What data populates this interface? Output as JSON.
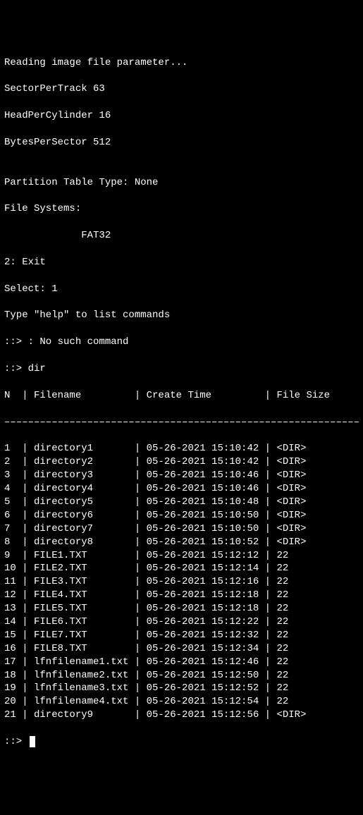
{
  "header": {
    "reading": "Reading image file parameter...",
    "sector": "SectorPerTrack 63",
    "head": "HeadPerCylinder 16",
    "bytes": "BytesPerSector 512",
    "blank1": "",
    "partition": "Partition Table Type: None",
    "fs_label": "File Systems:",
    "fs_value": "             FAT32",
    "exit": "2: Exit",
    "select": "Select: 1",
    "help": "Type \"help\" to list commands",
    "nosuch": "::> : No such command",
    "dircmd": "::> dir"
  },
  "table": {
    "header": "N  | Filename         | Create Time         | File Size",
    "separator": "––––––––––––––––––––––––––––––––––––––––––––––––––––––––––––––––"
  },
  "rows": [
    {
      "n": "1 ",
      "name": "directory1      ",
      "time": "05-26-2021 15:10:42",
      "size": "<DIR>"
    },
    {
      "n": "2 ",
      "name": "directory2      ",
      "time": "05-26-2021 15:10:42",
      "size": "<DIR>"
    },
    {
      "n": "3 ",
      "name": "directory3      ",
      "time": "05-26-2021 15:10:46",
      "size": "<DIR>"
    },
    {
      "n": "4 ",
      "name": "directory4      ",
      "time": "05-26-2021 15:10:46",
      "size": "<DIR>"
    },
    {
      "n": "5 ",
      "name": "directory5      ",
      "time": "05-26-2021 15:10:48",
      "size": "<DIR>"
    },
    {
      "n": "6 ",
      "name": "directory6      ",
      "time": "05-26-2021 15:10:50",
      "size": "<DIR>"
    },
    {
      "n": "7 ",
      "name": "directory7      ",
      "time": "05-26-2021 15:10:50",
      "size": "<DIR>"
    },
    {
      "n": "8 ",
      "name": "directory8      ",
      "time": "05-26-2021 15:10:52",
      "size": "<DIR>"
    },
    {
      "n": "9 ",
      "name": "FILE1.TXT       ",
      "time": "05-26-2021 15:12:12",
      "size": "22"
    },
    {
      "n": "10",
      "name": "FILE2.TXT       ",
      "time": "05-26-2021 15:12:14",
      "size": "22"
    },
    {
      "n": "11",
      "name": "FILE3.TXT       ",
      "time": "05-26-2021 15:12:16",
      "size": "22"
    },
    {
      "n": "12",
      "name": "FILE4.TXT       ",
      "time": "05-26-2021 15:12:18",
      "size": "22"
    },
    {
      "n": "13",
      "name": "FILE5.TXT       ",
      "time": "05-26-2021 15:12:18",
      "size": "22"
    },
    {
      "n": "14",
      "name": "FILE6.TXT       ",
      "time": "05-26-2021 15:12:22",
      "size": "22"
    },
    {
      "n": "15",
      "name": "FILE7.TXT       ",
      "time": "05-26-2021 15:12:32",
      "size": "22"
    },
    {
      "n": "16",
      "name": "FILE8.TXT       ",
      "time": "05-26-2021 15:12:34",
      "size": "22"
    },
    {
      "n": "17",
      "name": "lfnfilename1.txt",
      "time": "05-26-2021 15:12:46",
      "size": "22"
    },
    {
      "n": "18",
      "name": "lfnfilename2.txt",
      "time": "05-26-2021 15:12:50",
      "size": "22"
    },
    {
      "n": "19",
      "name": "lfnfilename3.txt",
      "time": "05-26-2021 15:12:52",
      "size": "22"
    },
    {
      "n": "20",
      "name": "lfnfilename4.txt",
      "time": "05-26-2021 15:12:54",
      "size": "22"
    },
    {
      "n": "21",
      "name": "directory9      ",
      "time": "05-26-2021 15:12:56",
      "size": "<DIR>"
    }
  ],
  "prompt": "::> "
}
